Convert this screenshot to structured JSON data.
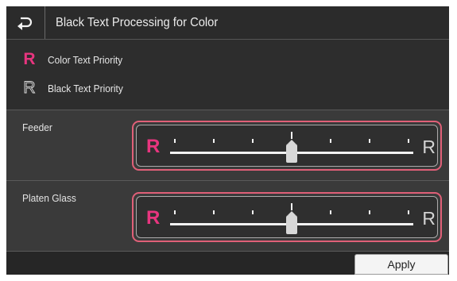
{
  "header": {
    "title": "Black Text Processing for Color",
    "back_icon": "back-arrow-icon"
  },
  "legend": {
    "items": [
      {
        "symbol": "R",
        "label": "Color Text Priority",
        "color": "#e8357f"
      },
      {
        "symbol": "R",
        "label": "Black Text Priority",
        "color": "#e6e6e6"
      }
    ]
  },
  "sections": [
    {
      "label": "Feeder",
      "left_symbol": "R",
      "right_symbol": "R",
      "steps": 7,
      "value": 4
    },
    {
      "label": "Platen Glass",
      "left_symbol": "R",
      "right_symbol": "R",
      "steps": 7,
      "value": 4
    }
  ],
  "footer": {
    "apply_label": "Apply"
  },
  "colors": {
    "accent": "#e8357f",
    "highlight_border": "#e06078"
  }
}
